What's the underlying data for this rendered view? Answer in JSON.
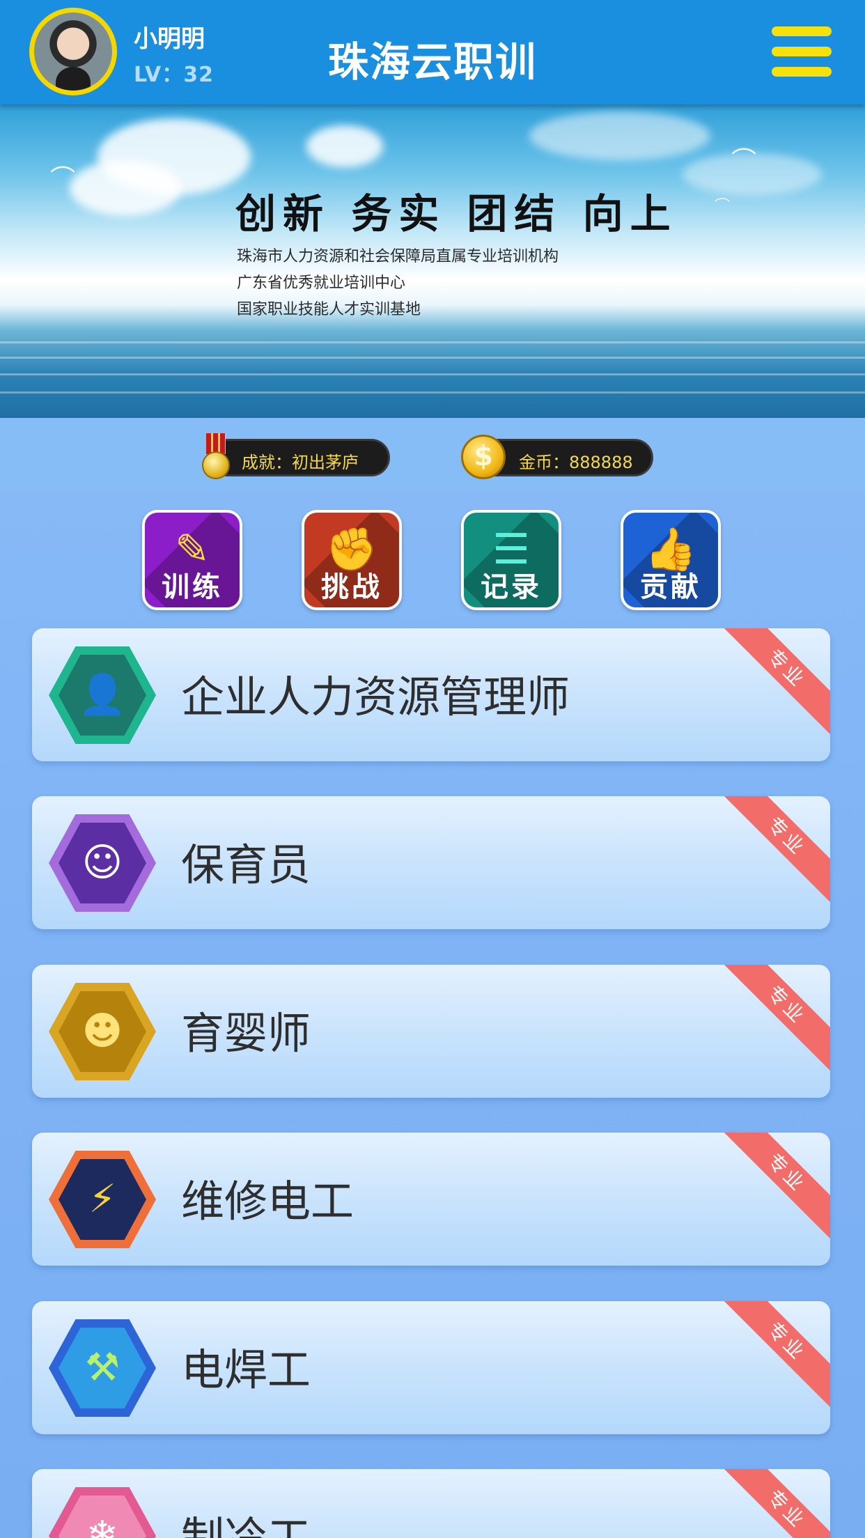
{
  "user": {
    "name": "小明明",
    "level": "LV：32"
  },
  "header": {
    "title": "珠海云职训"
  },
  "banner": {
    "slogan": "创新 务实 团结 向上",
    "lines": [
      "珠海市人力资源和社会保障局直属专业培训机构",
      "广东省优秀就业培训中心",
      "国家职业技能人才实训基地"
    ]
  },
  "stats": {
    "achievement": "成就：初出茅庐",
    "coins": "金币：888888"
  },
  "actions": [
    {
      "label": "训练",
      "icon": "edit-note-icon",
      "color": "#8b1ec9"
    },
    {
      "label": "挑战",
      "icon": "fist-icon",
      "color": "#c23a22"
    },
    {
      "label": "记录",
      "icon": "records-icon",
      "color": "#138f7f"
    },
    {
      "label": "贡献",
      "icon": "thumbs-up-icon",
      "color": "#1d63d6"
    }
  ],
  "courses": [
    {
      "title": "企业人力资源管理师",
      "tag": "专业",
      "icon": "manager-icon",
      "hex_outer": "#1fb58f",
      "hex_inner": "#1c7a6c"
    },
    {
      "title": "保育员",
      "tag": "专业",
      "icon": "baby-icon",
      "hex_outer": "#a46bdc",
      "hex_inner": "#5b2fa3"
    },
    {
      "title": "育婴师",
      "tag": "专业",
      "icon": "infant-face-icon",
      "hex_outer": "#d9a522",
      "hex_inner": "#b5820c"
    },
    {
      "title": "维修电工",
      "tag": "专业",
      "icon": "electrician-icon",
      "hex_outer": "#ee6f3a",
      "hex_inner": "#1d2a5e"
    },
    {
      "title": "电焊工",
      "tag": "专业",
      "icon": "welder-icon",
      "hex_outer": "#2d64d8",
      "hex_inner": "#2f9ce6"
    },
    {
      "title": "制冷工",
      "tag": "专业",
      "icon": "snowflake-icon",
      "hex_outer": "#e35a92",
      "hex_inner": "#f08ab5"
    }
  ]
}
